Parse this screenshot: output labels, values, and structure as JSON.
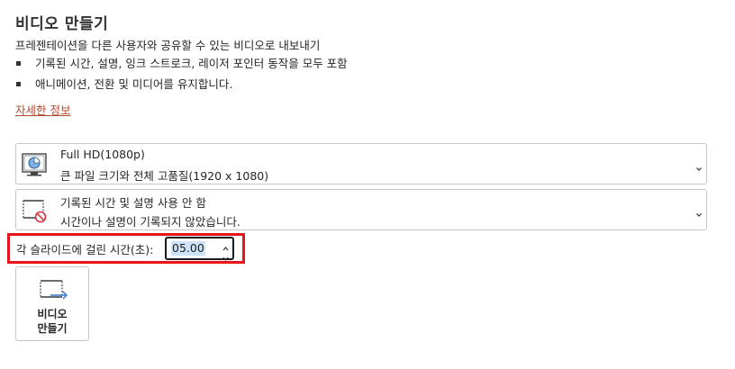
{
  "header": {
    "title": "비디오 만들기",
    "description": "프레젠테이션을 다른 사용자와 공유할 수 있는 비디오로 내보내기"
  },
  "bullets": [
    "기록된 시간, 설명, 잉크 스트로크, 레이저 포인터 동작을 모두 포함",
    "애니메이션, 전환 및 미디어를 유지합니다."
  ],
  "details_link": "자세한 정보",
  "quality_dropdown": {
    "selected_title": "Full HD(1080p)",
    "selected_desc": "큰 파일 크기와 전체 고품질(1920 x 1080)",
    "icon": "monitor-chart-icon"
  },
  "timing_dropdown": {
    "selected_title": "기록된 시간 및 설명 사용 안 함",
    "selected_desc": "시간이나 설명이 기록되지 않았습니다.",
    "icon": "no-timing-icon"
  },
  "slide_time": {
    "label": "각 슬라이드에 걸린 시간(초):",
    "value": "05.00"
  },
  "make_video_button": {
    "line1": "비디오",
    "line2": "만들기",
    "icon": "export-video-icon"
  },
  "colors": {
    "highlight": "#e8141b",
    "link": "#b7472a",
    "selection": "#cfe3f8"
  }
}
